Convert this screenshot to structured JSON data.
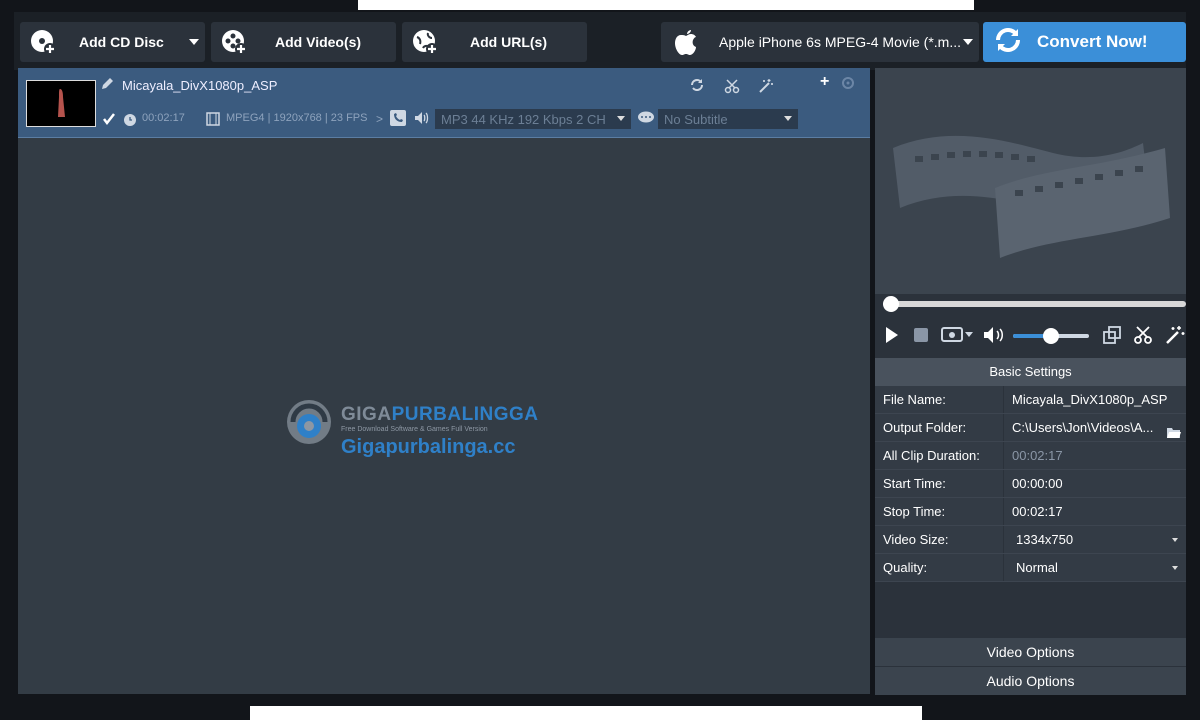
{
  "toolbar": {
    "add_cd": "Add CD Disc",
    "add_videos": "Add Video(s)",
    "add_url": "Add URL(s)",
    "profile": "Apple iPhone 6s MPEG-4 Movie (*.m...",
    "convert": "Convert Now!"
  },
  "file": {
    "name": "Micayala_DivX1080p_ASP",
    "duration": "00:02:17",
    "video_info": "MPEG4 | 1920x768 | 23 FPS",
    "audio": "MP3 44 KHz 192 Kbps 2 CH",
    "subtitle": "No Subtitle"
  },
  "watermark": {
    "brand_giga": "GIGA",
    "brand_purbalingga": "PURBALINGGA",
    "tagline": "Free Download Software & Games Full Version",
    "site": "Gigapurbalinga.cc"
  },
  "settings": {
    "header": "Basic Settings",
    "rows": [
      {
        "key": "File Name:",
        "value": "Micayala_DivX1080p_ASP"
      },
      {
        "key": "Output Folder:",
        "value": "C:\\Users\\Jon\\Videos\\A..."
      },
      {
        "key": "All Clip Duration:",
        "value": "00:02:17"
      },
      {
        "key": "Start Time:",
        "value": "00:00:00"
      },
      {
        "key": "Stop Time:",
        "value": "00:02:17"
      },
      {
        "key": "Video Size:",
        "value": "1334x750"
      },
      {
        "key": "Quality:",
        "value": "Normal"
      }
    ],
    "video_options": "Video Options",
    "audio_options": "Audio Options"
  },
  "colors": {
    "accent": "#3b8fd8",
    "selected_row": "#3b5b7f",
    "panel": "#333c45"
  }
}
